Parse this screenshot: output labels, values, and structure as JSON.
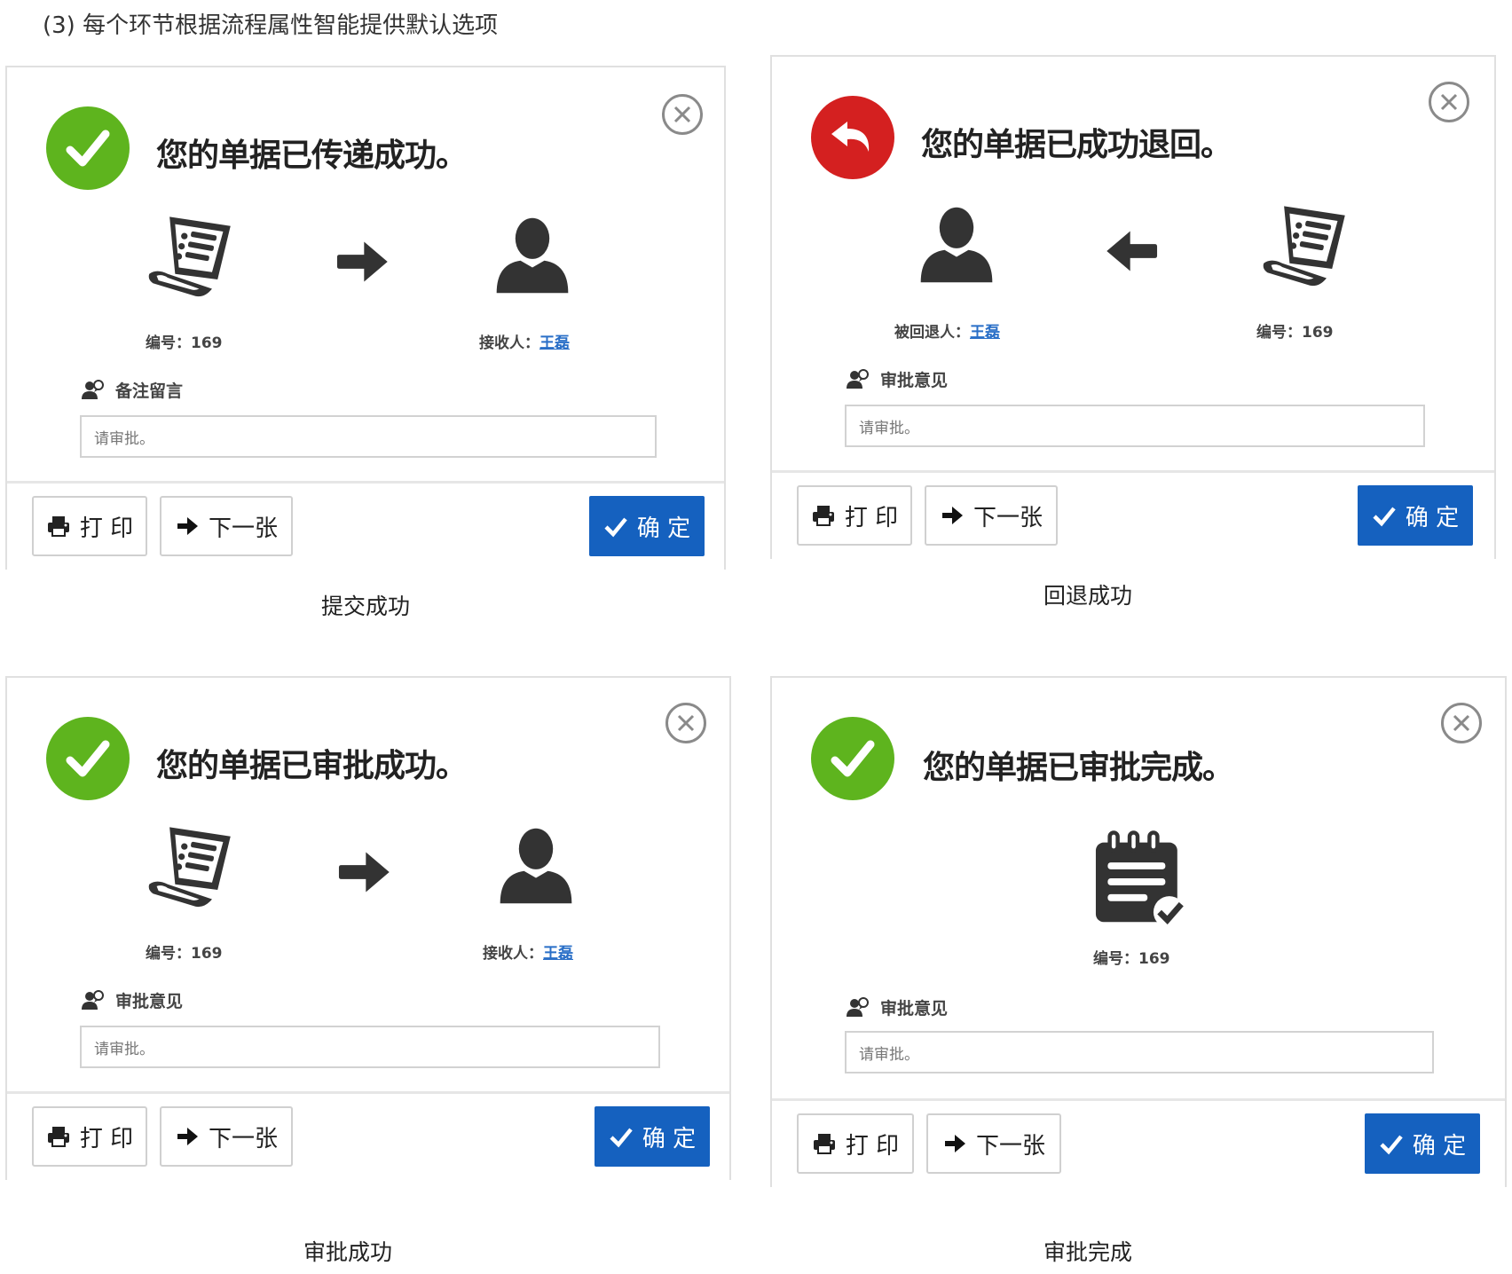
{
  "heading": "(3) 每个环节根据流程属性智能提供默认选项",
  "panels": [
    {
      "message": "您的单据已传递成功。",
      "number_caption": "编号：169",
      "person_prefix": "接收人：",
      "person_name": "王磊",
      "note_label": "备注留言",
      "note_value": "请审批。",
      "print_label": "打 印",
      "next_label": "下一张",
      "ok_label": "确 定",
      "caption": "提交成功"
    },
    {
      "message": "您的单据已成功退回。",
      "number_caption": "编号：169",
      "person_prefix": "被回退人：",
      "person_name": "王磊",
      "note_label": "审批意见",
      "note_value": "请审批。",
      "print_label": "打 印",
      "next_label": "下一张",
      "ok_label": "确 定",
      "caption": "回退成功"
    },
    {
      "message": "您的单据已审批成功。",
      "number_caption": "编号：169",
      "person_prefix": "接收人：",
      "person_name": "王磊",
      "note_label": "审批意见",
      "note_value": "请审批。",
      "print_label": "打 印",
      "next_label": "下一张",
      "ok_label": "确 定",
      "caption": "审批成功"
    },
    {
      "message": "您的单据已审批完成。",
      "number_caption": "编号：169",
      "note_label": "审批意见",
      "note_value": "请审批。",
      "print_label": "打 印",
      "next_label": "下一张",
      "ok_label": "确 定",
      "caption": "审批完成"
    }
  ],
  "icons": {
    "success": "check-circle-icon",
    "returned": "undo-circle-icon",
    "close": "close-circle-icon",
    "document": "document-scroll-icon",
    "person": "user-icon",
    "arrow_right": "arrow-right-icon",
    "arrow_left": "arrow-left-icon",
    "complete": "notepad-check-icon",
    "note": "user-comment-icon",
    "print": "printer-icon",
    "next": "arrow-right-icon",
    "ok": "check-icon"
  },
  "colors": {
    "success_green": "#5eb41e",
    "return_red": "#d42020",
    "primary_blue": "#1561bf",
    "link_blue": "#2a6fc7"
  }
}
